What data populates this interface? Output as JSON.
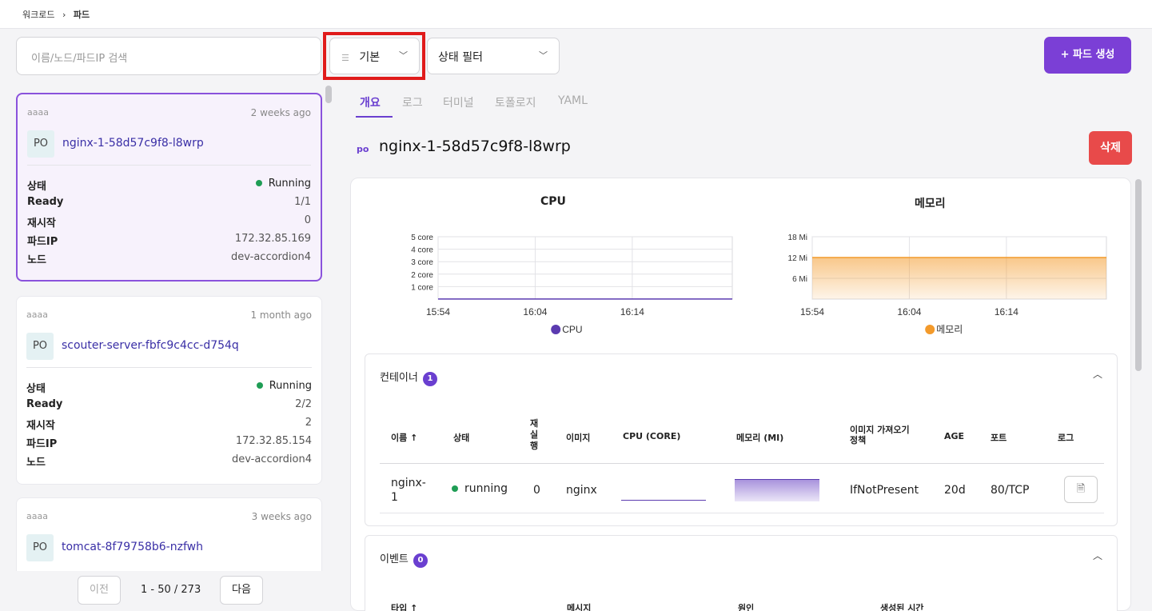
{
  "breadcrumb": {
    "parent": "워크로드",
    "sep": "›",
    "current": "파드"
  },
  "toolbar": {
    "search_placeholder": "이름/노드/파드IP 검색",
    "preset_label": "기본",
    "filter_label": "상태 필터",
    "create_label": "+ 파드 생성"
  },
  "pods": [
    {
      "namespace": "aaaa",
      "age": "2 weeks ago",
      "kind": "PO",
      "name": "nginx-1-58d57c9f8-l8wrp",
      "status_label": "상태",
      "status": "Running",
      "ready_label": "Ready",
      "ready": "1/1",
      "restart_label": "재시작",
      "restarts": "0",
      "ip_label": "파드IP",
      "ip": "172.32.85.169",
      "node_label": "노드",
      "node": "dev-accordion4"
    },
    {
      "namespace": "aaaa",
      "age": "1 month ago",
      "kind": "PO",
      "name": "scouter-server-fbfc9c4cc-d754q",
      "status_label": "상태",
      "status": "Running",
      "ready_label": "Ready",
      "ready": "2/2",
      "restart_label": "재시작",
      "restarts": "2",
      "ip_label": "파드IP",
      "ip": "172.32.85.154",
      "node_label": "노드",
      "node": "dev-accordion4"
    },
    {
      "namespace": "aaaa",
      "age": "3 weeks ago",
      "kind": "PO",
      "name": "tomcat-8f79758b6-nzfwh"
    }
  ],
  "pagination": {
    "prev": "이전",
    "range": "1 - 50 / 273",
    "next": "다음"
  },
  "tabs": [
    "개요",
    "로그",
    "터미널",
    "토폴로지",
    "YAML"
  ],
  "detail": {
    "kind": "po",
    "name": "nginx-1-58d57c9f8-l8wrp",
    "delete_label": "삭제"
  },
  "chart_data": [
    {
      "type": "line",
      "title": "CPU",
      "x": [
        "15:54",
        "16:04",
        "16:14"
      ],
      "yticks": [
        "5 core",
        "4 core",
        "3 core",
        "2 core",
        "1 core"
      ],
      "ylim": [
        0,
        5
      ],
      "series": [
        {
          "name": "CPU",
          "values": [
            0.01,
            0.01,
            0.01
          ],
          "color": "#5b3bb0"
        }
      ]
    },
    {
      "type": "area",
      "title": "메모리",
      "x": [
        "15:54",
        "16:04",
        "16:14"
      ],
      "yticks": [
        "18 Mi",
        "12 Mi",
        "6 Mi"
      ],
      "ylim": [
        0,
        18
      ],
      "series": [
        {
          "name": "메모리",
          "values": [
            12,
            12,
            12
          ],
          "color": "#f39a2b"
        }
      ]
    }
  ],
  "containers": {
    "title": "컨테이너",
    "count": "1",
    "headers": {
      "name": "이름 ↑",
      "status": "상태",
      "restarts": "재\n실\n행",
      "image": "이미지",
      "cpu": "CPU (CORE)",
      "memory": "메모리 (MI)",
      "pull_policy": "이미지 가져오기\n정책",
      "age": "AGE",
      "port": "포트",
      "log": "로그"
    },
    "rows": [
      {
        "name": "nginx-\n1",
        "status": "running",
        "restarts": "0",
        "image": "nginx",
        "pull_policy": "IfNotPresent",
        "age": "20d",
        "port": "80/TCP"
      }
    ]
  },
  "events": {
    "title": "이벤트",
    "count": "0",
    "headers": {
      "type": "타입 ↑",
      "message": "메시지",
      "reason": "원인",
      "created": "생성된 시간"
    }
  }
}
